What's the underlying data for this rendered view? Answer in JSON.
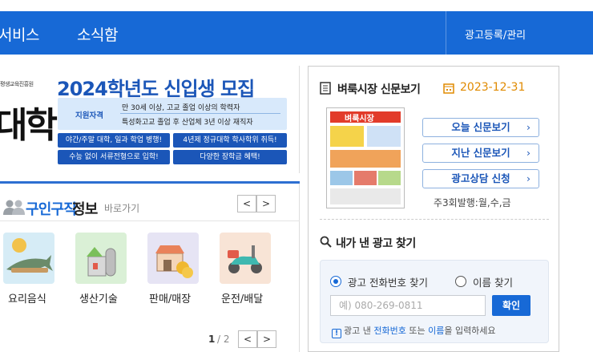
{
  "nav": {
    "items": [
      "서비스",
      "소식함"
    ],
    "right": "광고등록/관리"
  },
  "banner": {
    "org": "평생교육진흥원",
    "big": "대학",
    "title": "2024학년도 신입생 모집",
    "qual_label": "지원자격",
    "qual_line1": "만 30세 이상, 고교 졸업 이상의 학력자",
    "qual_line2": "특성화고교 졸업 후 산업체 3년 이상 재직자",
    "pills": [
      "야간/주말 대학, 일과 학업 병행!",
      "4년제 정규대학 학사학위 취득!",
      "수능 없이 서류전형으로 입학!",
      "다양한 장학금 혜택!"
    ]
  },
  "jobs": {
    "title_a": "구인구직",
    "title_b": "정보",
    "sub": "바로가기",
    "prev": "<",
    "next": ">",
    "categories": [
      "요리음식",
      "생산기술",
      "판매/매장",
      "운전/배달"
    ],
    "page": "1",
    "total": "/ 2"
  },
  "newspaper": {
    "title": "벼룩시장 신문보기",
    "date": "2023-12-31",
    "thumb_title": "벼룩시장",
    "buttons": [
      "오늘 신문보기",
      "지난 신문보기",
      "광고상담 신청"
    ],
    "chev": "›",
    "issue": "주3회발행:월,수,금"
  },
  "find": {
    "title": "내가 낸 광고 찾기",
    "radio1": "광고 전화번호 찾기",
    "radio2": "이름 찾기",
    "placeholder": "예) 080-269-0811",
    "confirm": "확인",
    "hint_icon": "!",
    "hint_a": "광고 낸 ",
    "hint_b": "전화번호",
    "hint_c": " 또는 ",
    "hint_d": "이름",
    "hint_e": "을 입력하세요"
  },
  "colors": {
    "brand": "#1769d6",
    "accent_date": "#e08a00"
  }
}
